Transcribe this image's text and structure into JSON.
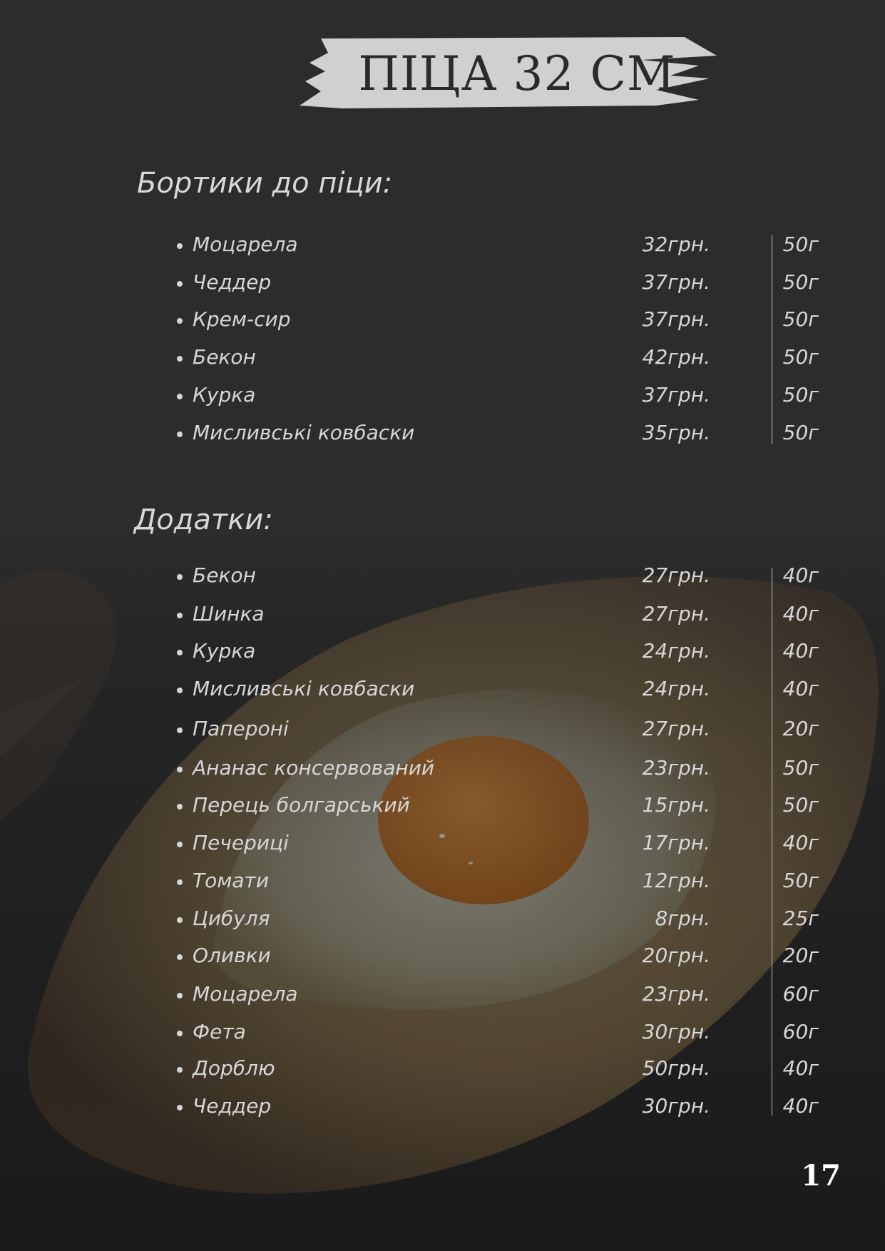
{
  "title": "ПІЦА 32 СМ",
  "sections": [
    {
      "title": "Бортики до піци:",
      "items": [
        {
          "name": "Моцарела",
          "price": "32грн.",
          "weight": "50г"
        },
        {
          "name": "Чеддер",
          "price": "37грн.",
          "weight": "50г"
        },
        {
          "name": "Крем-сир",
          "price": "37грн.",
          "weight": "50г"
        },
        {
          "name": "Бекон",
          "price": "42грн.",
          "weight": "50г"
        },
        {
          "name": "Курка",
          "price": "37грн.",
          "weight": "50г"
        },
        {
          "name": "Мисливські ковбаски",
          "price": "35грн.",
          "weight": "50г"
        }
      ]
    },
    {
      "title": "Додатки:",
      "items": [
        {
          "name": "Бекон",
          "price": "27грн.",
          "weight": "40г"
        },
        {
          "name": "Шинка",
          "price": "27грн.",
          "weight": "40г"
        },
        {
          "name": "Курка",
          "price": "24грн.",
          "weight": "40г"
        },
        {
          "name": "Мисливські ковбаски",
          "price": "24грн.",
          "weight": "40г"
        },
        {
          "name": "Папероні",
          "price": "27грн.",
          "weight": "20г"
        },
        {
          "name": "Ананас консервований",
          "price": "23грн.",
          "weight": "50г"
        },
        {
          "name": "Перець болгарський",
          "price": "15грн.",
          "weight": "50г"
        },
        {
          "name": "Печериці",
          "price": "17грн.",
          "weight": "40г"
        },
        {
          "name": "Томати",
          "price": "12грн.",
          "weight": "50г"
        },
        {
          "name": "Цибуля",
          "price": "8грн.",
          "weight": "25г"
        },
        {
          "name": "Оливки",
          "price": "20грн.",
          "weight": "20г"
        },
        {
          "name": "Моцарела",
          "price": "23грн.",
          "weight": "60г"
        },
        {
          "name": "Фета",
          "price": "30грн.",
          "weight": "60г"
        },
        {
          "name": "Дорблю",
          "price": "50грн.",
          "weight": "40г"
        },
        {
          "name": "Чеддер",
          "price": "30грн.",
          "weight": "40г"
        }
      ]
    }
  ],
  "page_number": "17",
  "colors": {
    "background": "#2b2b2b",
    "text": "#d6d6d6",
    "title_banner": "#d0d0ce",
    "egg_yolk": "#c8741e"
  }
}
